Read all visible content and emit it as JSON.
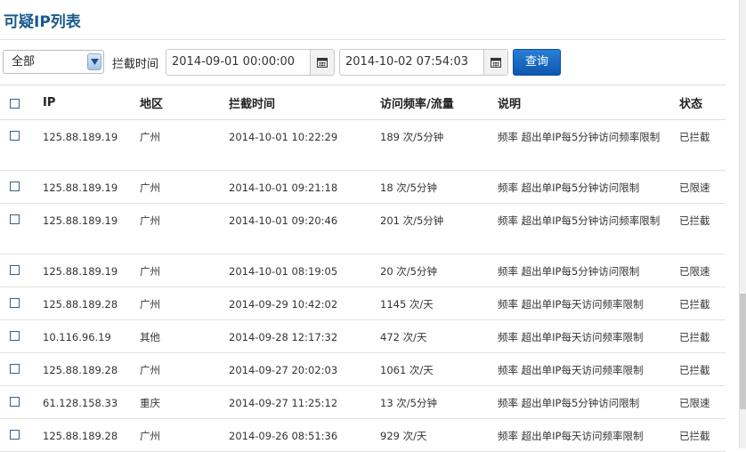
{
  "page": {
    "title": "可疑IP列表"
  },
  "filter": {
    "type_selected": "全部",
    "time_label": "拦截时间",
    "start_time": "2014-09-01 00:00:00",
    "end_time": "2014-10-02 07:54:03",
    "query_label": "查询"
  },
  "table": {
    "headers": {
      "ip": "IP",
      "region": "地区",
      "time": "拦截时间",
      "freq": "访问频率/流量",
      "desc": "说明",
      "status": "状态"
    },
    "rows": [
      {
        "ip": "125.88.189.19",
        "region": "广州",
        "time": "2014-10-01 10:22:29",
        "freq": "189 次/5分钟",
        "desc": "频率 超出单IP每5分钟访问频率限制",
        "status": "已拦截"
      },
      {
        "ip": "125.88.189.19",
        "region": "广州",
        "time": "2014-10-01 09:21:18",
        "freq": "18 次/5分钟",
        "desc": "频率 超出单IP每5分钟访问限制",
        "status": "已限速"
      },
      {
        "ip": "125.88.189.19",
        "region": "广州",
        "time": "2014-10-01 09:20:46",
        "freq": "201 次/5分钟",
        "desc": "频率 超出单IP每5分钟访问频率限制",
        "status": "已拦截"
      },
      {
        "ip": "125.88.189.19",
        "region": "广州",
        "time": "2014-10-01 08:19:05",
        "freq": "20 次/5分钟",
        "desc": "频率 超出单IP每5分钟访问限制",
        "status": "已限速"
      },
      {
        "ip": "125.88.189.28",
        "region": "广州",
        "time": "2014-09-29 10:42:02",
        "freq": "1145 次/天",
        "desc": "频率 超出单IP每天访问频率限制",
        "status": "已拦截"
      },
      {
        "ip": "10.116.96.19",
        "region": "其他",
        "time": "2014-09-28 12:17:32",
        "freq": "472 次/天",
        "desc": "频率 超出单IP每天访问频率限制",
        "status": "已拦截"
      },
      {
        "ip": "125.88.189.28",
        "region": "广州",
        "time": "2014-09-27 20:02:03",
        "freq": "1061 次/天",
        "desc": "频率 超出单IP每天访问频率限制",
        "status": "已拦截"
      },
      {
        "ip": "61.128.158.33",
        "region": "重庆",
        "time": "2014-09-27 11:25:12",
        "freq": "13 次/5分钟",
        "desc": "频率 超出单IP每5分钟访问限制",
        "status": "已限速"
      },
      {
        "ip": "125.88.189.28",
        "region": "广州",
        "time": "2014-09-26 08:51:36",
        "freq": "929 次/天",
        "desc": "频率 超出单IP每天访问频率限制",
        "status": "已拦截"
      }
    ]
  }
}
